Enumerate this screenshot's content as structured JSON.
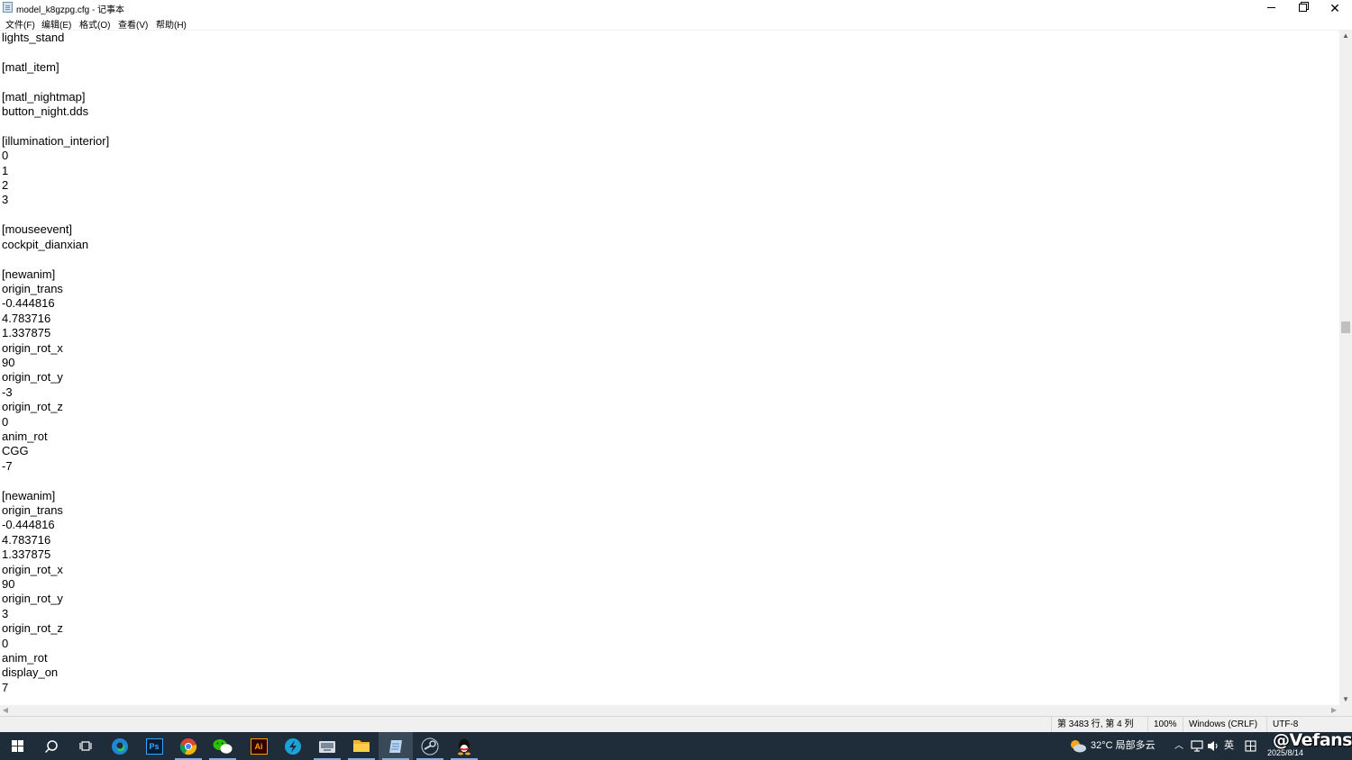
{
  "window": {
    "title": "model_k8gzpg.cfg - 记事本"
  },
  "menu": [
    "文件(F)",
    "编辑(E)",
    "格式(O)",
    "查看(V)",
    "帮助(H)"
  ],
  "editor": {
    "lines": [
      "lights_stand",
      "",
      "[matl_item]",
      "",
      "[matl_nightmap]",
      "button_night.dds",
      "",
      "[illumination_interior]",
      "0",
      "1",
      "2",
      "3",
      "",
      "[mouseevent]",
      "cockpit_dianxian",
      "",
      "[newanim]",
      "origin_trans",
      "-0.444816",
      "4.783716",
      "1.337875",
      "origin_rot_x",
      "90",
      "origin_rot_y",
      "-3",
      "origin_rot_z",
      "0",
      "anim_rot",
      "CGG",
      "-7",
      "",
      "[newanim]",
      "origin_trans",
      "-0.444816",
      "4.783716",
      "1.337875",
      "origin_rot_x",
      "90",
      "origin_rot_y",
      "3",
      "origin_rot_z",
      "0",
      "anim_rot",
      "display_on",
      "7"
    ]
  },
  "status": {
    "position": "第 3483 行, 第 4 列",
    "zoom": "100%",
    "line_ending": "Windows (CRLF)",
    "encoding": "UTF-8"
  },
  "taskbar": {
    "apps": [
      "start-icon",
      "search-icon",
      "task-view-icon",
      "edge-icon",
      "photoshop-icon",
      "chrome-icon",
      "wechat-icon",
      "illustrator-icon",
      "app-icon",
      "screenshot-tool-icon",
      "file-explorer-icon",
      "notepad-icon",
      "steam-icon",
      "qq-icon"
    ],
    "ps_label": "Ps",
    "ai_label": "Ai",
    "weather": "32°C 局部多云",
    "ime": "英",
    "date": "2025/8/14",
    "watermark": "@Vefans"
  }
}
